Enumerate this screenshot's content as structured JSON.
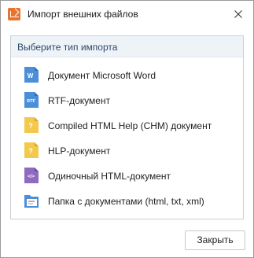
{
  "window": {
    "title": "Импорт внешних файлов"
  },
  "panel": {
    "header": "Выберите тип импорта",
    "items": [
      {
        "label": "Документ Microsoft Word",
        "icon": "word-document-icon",
        "icon_text": "W",
        "color": "#4a8fd8"
      },
      {
        "label": "RTF-документ",
        "icon": "rtf-document-icon",
        "icon_text": "RTF",
        "color": "#4a8fd8"
      },
      {
        "label": "Compiled HTML Help (CHM) документ",
        "icon": "chm-help-icon",
        "icon_text": "?",
        "color": "#f2c94c"
      },
      {
        "label": "HLP-документ",
        "icon": "hlp-help-icon",
        "icon_text": "?",
        "color": "#f2c94c"
      },
      {
        "label": "Одиночный HTML-документ",
        "icon": "html-document-icon",
        "icon_text": "</>",
        "color": "#8e6bbf"
      },
      {
        "label": "Папка с документами (html, txt, xml)",
        "icon": "documents-folder-icon",
        "color": "#4a8fd8"
      }
    ]
  },
  "footer": {
    "close_label": "Закрыть"
  }
}
